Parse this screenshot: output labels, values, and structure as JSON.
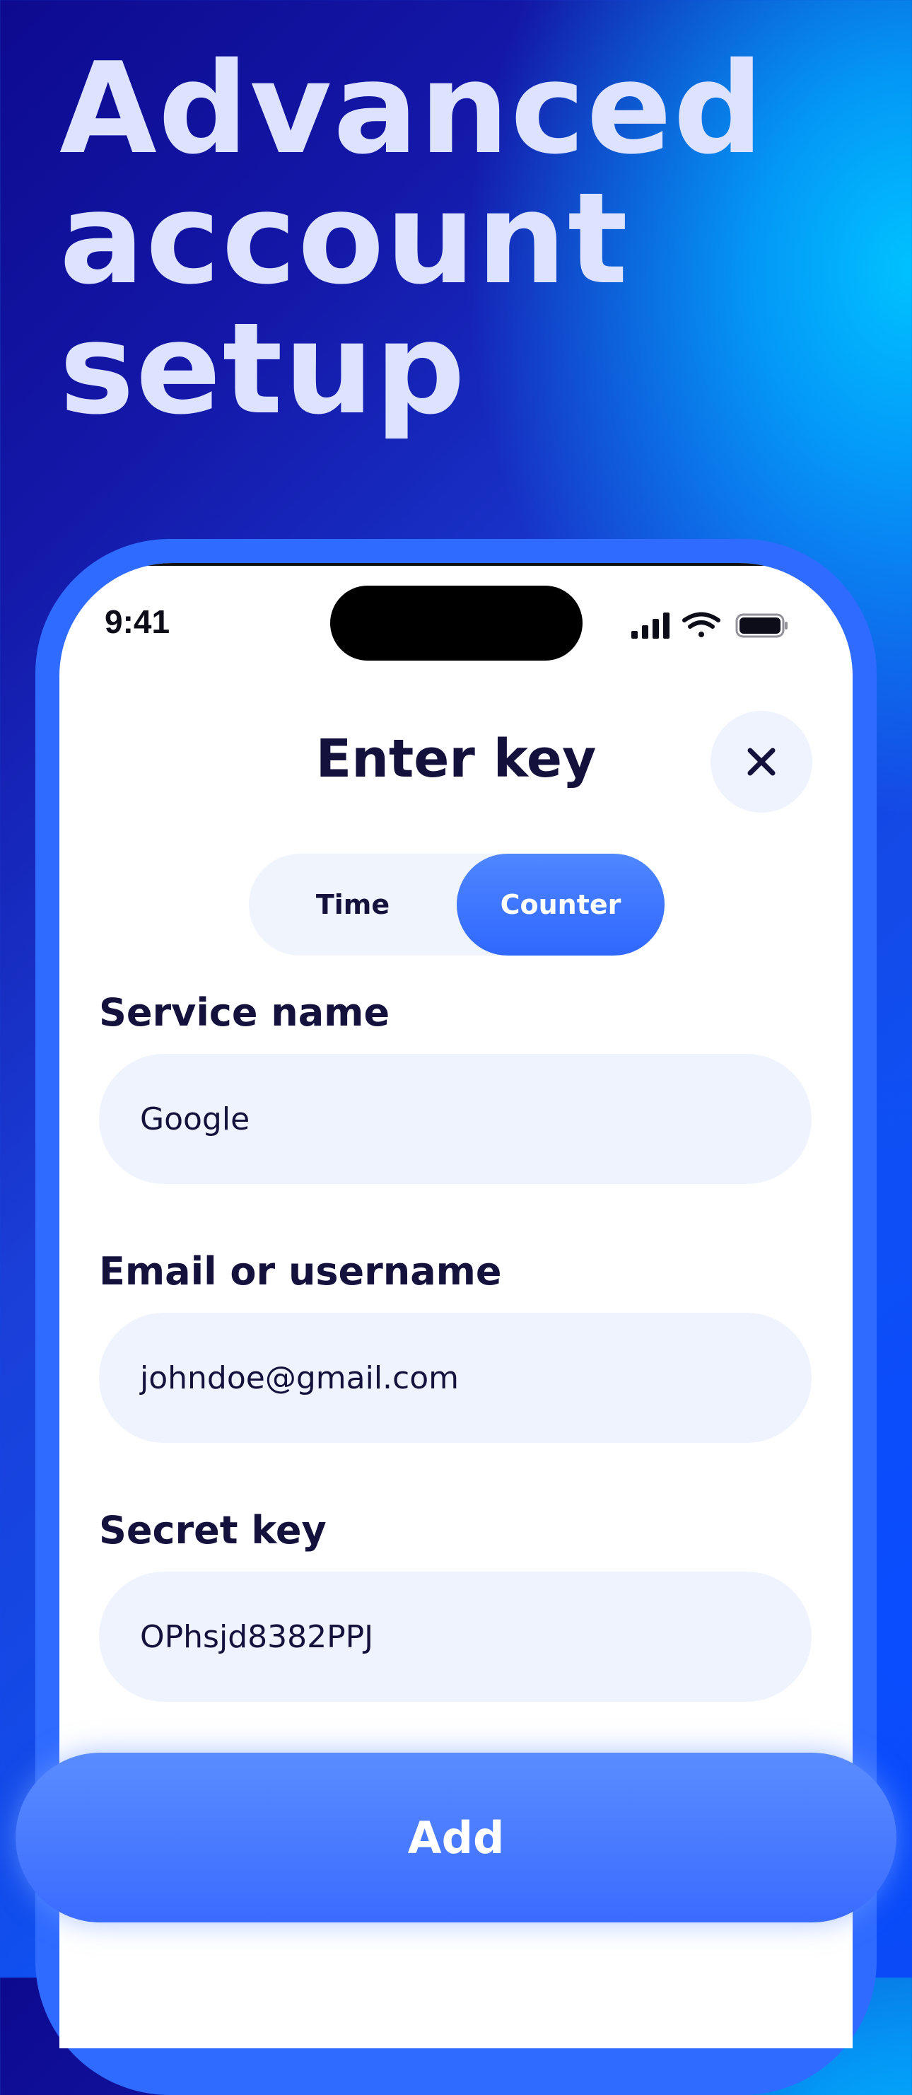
{
  "headline": {
    "line1": "Advanced",
    "line2": "account",
    "line3": "setup"
  },
  "status_bar": {
    "time": "9:41"
  },
  "sheet": {
    "title": "Enter key"
  },
  "segmented": {
    "options": [
      "Time",
      "Counter"
    ],
    "selected": "Counter"
  },
  "form": {
    "service_name_label": "Service name",
    "service_name_value": "Google",
    "email_label": "Email or username",
    "email_value": "johndoe@gmail.com",
    "secret_label": "Secret key",
    "secret_value": "OPhsjd8382PPJ"
  },
  "actions": {
    "add_label": "Add"
  },
  "colors": {
    "accent": "#3a6bff",
    "field_bg": "#eef3fd",
    "text_dark": "#14123c",
    "headline_text": "#dde3ff"
  }
}
